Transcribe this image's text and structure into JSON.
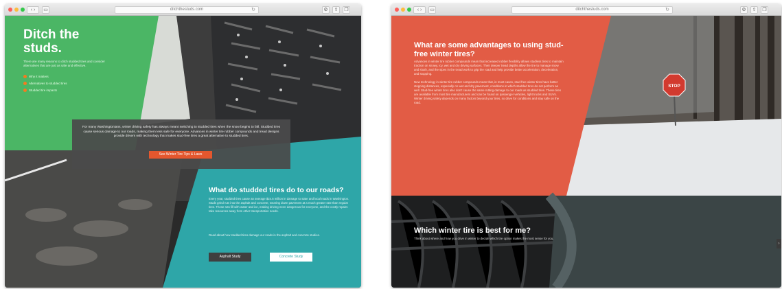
{
  "left_window": {
    "url": "ditchthestuds.com",
    "hero": {
      "title": "Ditch the studs.",
      "subtitle": "There are many reasons to ditch studded tires and consider alternatives that are just as safe and effective.",
      "links": [
        "Why it matters",
        "Alternatives to studded tires",
        "Studded tire impacts"
      ]
    },
    "intro_box": {
      "text": "For many Washingtonians, winter driving safety has always meant switching to studded tires when the snow begins to fall. Studded tires cause serious damage to our roads, making them less safe for everyone. Advances in winter tire rubber compounds and tread designs provide drivers with technology that makes stud-free tires a great alternative to studded tires.",
      "button": "See Winter Tire Tips & Laws"
    },
    "studded_section": {
      "title": "What do studded tires do to our roads?",
      "body": "Every year, studded tires cause an average $24.5 million in damage to state and local roads in Washington. Studs grind ruts into the asphalt and concrete, wearing down pavement at a much greater rate than regular tires. These ruts fill with water and ice, making driving more dangerous for everyone, and the costly repairs take resources away from other transportation needs.",
      "note": "Read about how studded tires damage our roads in the asphalt and concrete studies.",
      "button_asphalt": "Asphalt Study",
      "button_concrete": "Concrete Study"
    }
  },
  "right_window": {
    "url": "ditchthestuds.com",
    "advantages": {
      "title": "What are some advantages to using stud-free winter tires?",
      "para1": "Advances in winter tire rubber compounds mean that increased rubber flexibility allows studless tires to maintain traction on snowy, icy, wet and dry driving surfaces. Their deeper tread depths allow the tire to manage snow and slush, and the sipes in the tread work to grip the road and help provide better acceleration, deceleration, and stopping.",
      "para2": "New technology in winter tire rubber compounds mean that, in most cases, stud-free winter tires have better stopping distances, especially on wet and dry pavement, conditions in which studded tires do not perform as well. Stud-free winter tires also don't cause the same rutting damage to our roads as studded tires. These tires are available from most tire manufacturers and can be found on passenger vehicles, light trucks and SUVs. Winter driving safety depends on many factors beyond your tires, so drive for conditions and stay safe on the road."
    },
    "which": {
      "title": "Which winter tire is best for me?",
      "body": "Think about where and how you drive in winter to decide which tire option makes the most sense for you."
    },
    "stop_sign": "STOP"
  },
  "colors": {
    "green": "#4bb665",
    "teal": "#2ea6a8",
    "coral": "#e25c45",
    "dark_box": "#4a4a4a",
    "orange_button": "#e4572e",
    "dark_tread": "#1e1f20",
    "slate": "#3b4546"
  },
  "icons": [
    "traffic-lights",
    "back-icon",
    "forward-icon",
    "sidebar-icon",
    "reload-icon",
    "share-icon",
    "tabs-icon",
    "settings-icon",
    "chevron-right-icon"
  ]
}
